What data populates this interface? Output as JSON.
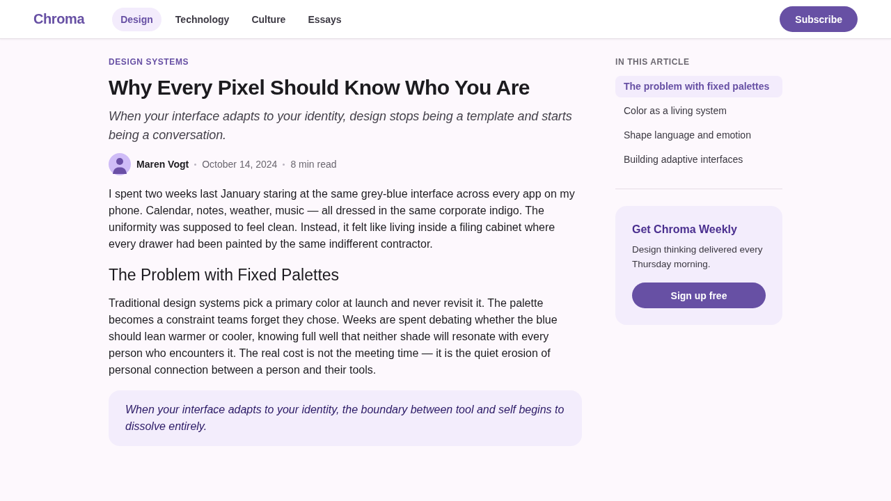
{
  "header": {
    "logo": "Chroma",
    "nav": [
      {
        "label": "Design",
        "selected": true
      },
      {
        "label": "Technology",
        "selected": false
      },
      {
        "label": "Culture",
        "selected": false
      },
      {
        "label": "Essays",
        "selected": false
      }
    ],
    "subscribe": "Subscribe"
  },
  "article": {
    "category": "DESIGN SYSTEMS",
    "title": "Why Every Pixel Should Know Who You Are",
    "subtitle": "When your interface adapts to your identity, design stops being a template and starts being a conversation.",
    "byline": {
      "author": "Maren Vogt",
      "date": "October 14, 2024",
      "read_time": "8 min read"
    },
    "body": [
      {
        "kind": "paragraph",
        "text": "I spent two weeks last January staring at the same grey-blue interface across every app on my phone. Calendar, notes, weather, music — all dressed in the same corporate indigo. The uniformity was supposed to feel clean. Instead, it felt like living inside a filing cabinet where every drawer had been painted by the same indifferent contractor."
      },
      {
        "kind": "heading",
        "text": "The Problem with Fixed Palettes"
      },
      {
        "kind": "paragraph",
        "text": "Traditional design systems pick a primary color at launch and never revisit it. The palette becomes a constraint teams forget they chose. Weeks are spent debating whether the blue should lean warmer or cooler, knowing full well that neither shade will resonate with every person who encounters it. The real cost is not the meeting time — it is the quiet erosion of personal connection between a person and their tools."
      },
      {
        "kind": "quote",
        "text": "When your interface adapts to your identity, the boundary between tool and self begins to dissolve entirely."
      }
    ]
  },
  "sidebar": {
    "toc_title": "IN THIS ARTICLE",
    "toc": [
      {
        "label": "The problem with fixed palettes",
        "selected": true
      },
      {
        "label": "Color as a living system",
        "selected": false
      },
      {
        "label": "Shape language and emotion",
        "selected": false
      },
      {
        "label": "Building adaptive interfaces",
        "selected": false
      }
    ],
    "newsletter": {
      "title": "Get Chroma Weekly",
      "text": "Design thinking delivered every Thursday morning.",
      "button": "Sign up free"
    }
  }
}
